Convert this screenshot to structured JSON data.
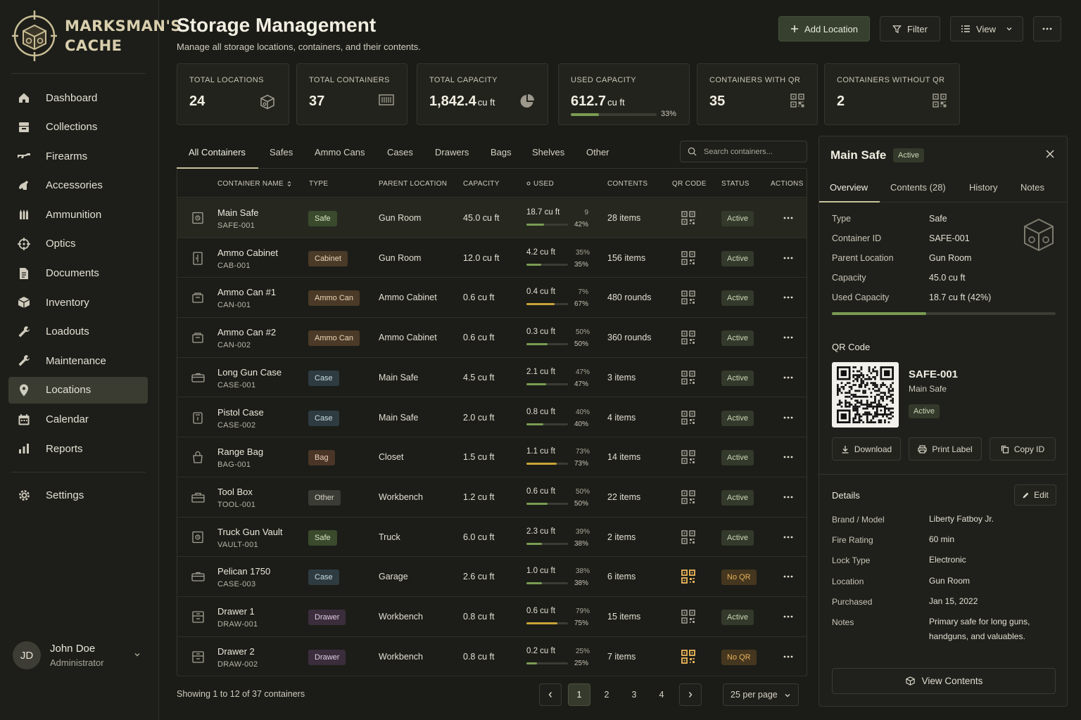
{
  "brand": {
    "line1": "MARKSMAN'S",
    "line2": "CACHE"
  },
  "nav": [
    {
      "label": "Dashboard",
      "icon": "home-icon"
    },
    {
      "label": "Collections",
      "icon": "collections-icon"
    },
    {
      "label": "Firearms",
      "icon": "rifle-icon"
    },
    {
      "label": "Accessories",
      "icon": "accessories-icon"
    },
    {
      "label": "Ammunition",
      "icon": "ammunition-icon"
    },
    {
      "label": "Optics",
      "icon": "crosshair-icon"
    },
    {
      "label": "Documents",
      "icon": "document-icon"
    },
    {
      "label": "Inventory",
      "icon": "box-icon"
    },
    {
      "label": "Loadouts",
      "icon": "wrench-icon"
    },
    {
      "label": "Maintenance",
      "icon": "wrench-icon"
    },
    {
      "label": "Locations",
      "icon": "location-pin-icon",
      "active": true
    },
    {
      "label": "Calendar",
      "icon": "calendar-icon"
    },
    {
      "label": "Reports",
      "icon": "bar-chart-icon"
    }
  ],
  "settings": {
    "label": "Settings",
    "icon": "gear-icon"
  },
  "user": {
    "initials": "JD",
    "name": "John Doe",
    "role": "Administrator"
  },
  "header": {
    "title": "Storage Management",
    "subtitle": "Manage all storage locations, containers, and their contents.",
    "add_label": "Add Location",
    "filter_label": "Filter",
    "view_label": "View"
  },
  "stats": [
    {
      "label": "TOTAL LOCATIONS",
      "value": "24",
      "unit": "",
      "icon": "cube-icon"
    },
    {
      "label": "TOTAL CONTAINERS",
      "value": "37",
      "unit": "",
      "icon": "container-icon"
    },
    {
      "label": "TOTAL CAPACITY",
      "value": "1,842.4",
      "unit": "cu ft",
      "icon": "pie-chart-icon"
    },
    {
      "label": "USED CAPACITY",
      "value": "612.7",
      "unit": "cu ft",
      "pct": "33%",
      "fraction": 0.33
    },
    {
      "label": "CONTAINERS WITH QR",
      "value": "35",
      "unit": "",
      "icon": "qr-icon"
    },
    {
      "label": "CONTAINERS WITHOUT QR",
      "value": "2",
      "unit": "",
      "icon": "qr-icon"
    }
  ],
  "tabs": [
    "All Containers",
    "Safes",
    "Ammo Cans",
    "Cases",
    "Drawers",
    "Bags",
    "Shelves",
    "Other"
  ],
  "search": {
    "placeholder": "Search containers..."
  },
  "columns": [
    "CONTAINER NAME",
    "TYPE",
    "PARENT LOCATION",
    "CAPACITY",
    "USED",
    "CONTENTS",
    "QR CODE",
    "STATUS",
    "ACTIONS"
  ],
  "rows": [
    {
      "name": "Main Safe",
      "id": "SAFE-001",
      "type": "Safe",
      "badge": "safe",
      "parent": "Gun Room",
      "capacity": "45.0 cu ft",
      "used": "18.7 cu ft",
      "pct_top": "9",
      "pct": "42%",
      "fraction": 0.42,
      "contents": "28 items",
      "qr": true,
      "status": "Active",
      "icon": "safe-icon",
      "selected": true
    },
    {
      "name": "Ammo Cabinet",
      "id": "CAB-001",
      "type": "Cabinet",
      "badge": "cabinet",
      "parent": "Gun Room",
      "capacity": "12.0 cu ft",
      "used": "4.2 cu ft",
      "pct_top": "35%",
      "pct": "35%",
      "fraction": 0.35,
      "contents": "156 items",
      "qr": true,
      "status": "Active",
      "icon": "cabinet-icon"
    },
    {
      "name": "Ammo Can #1",
      "id": "CAN-001",
      "type": "Ammo Can",
      "badge": "ammo",
      "parent": "Ammo Cabinet",
      "capacity": "0.6 cu ft",
      "used": "0.4 cu ft",
      "pct_top": "7%",
      "pct": "67%",
      "fraction": 0.67,
      "contents": "480 rounds",
      "qr": true,
      "status": "Active",
      "icon": "ammo-can-icon"
    },
    {
      "name": "Ammo Can #2",
      "id": "CAN-002",
      "type": "Ammo Can",
      "badge": "ammo",
      "parent": "Ammo Cabinet",
      "capacity": "0.6 cu ft",
      "used": "0.3 cu ft",
      "pct_top": "50%",
      "pct": "50%",
      "fraction": 0.5,
      "contents": "360 rounds",
      "qr": true,
      "status": "Active",
      "icon": "ammo-can-icon"
    },
    {
      "name": "Long Gun Case",
      "id": "CASE-001",
      "type": "Case",
      "badge": "case",
      "parent": "Main Safe",
      "capacity": "4.5 cu ft",
      "used": "2.1 cu ft",
      "pct_top": "47%",
      "pct": "47%",
      "fraction": 0.47,
      "contents": "3 items",
      "qr": true,
      "status": "Active",
      "icon": "case-icon"
    },
    {
      "name": "Pistol Case",
      "id": "CASE-002",
      "type": "Case",
      "badge": "case",
      "parent": "Main Safe",
      "capacity": "2.0 cu ft",
      "used": "0.8 cu ft",
      "pct_top": "40%",
      "pct": "40%",
      "fraction": 0.4,
      "contents": "4 items",
      "qr": true,
      "status": "Active",
      "icon": "pistol-case-icon"
    },
    {
      "name": "Range Bag",
      "id": "BAG-001",
      "type": "Bag",
      "badge": "bag",
      "parent": "Closet",
      "capacity": "1.5 cu ft",
      "used": "1.1 cu ft",
      "pct_top": "73%",
      "pct": "73%",
      "fraction": 0.73,
      "contents": "14 items",
      "qr": true,
      "status": "Active",
      "icon": "bag-icon"
    },
    {
      "name": "Tool Box",
      "id": "TOOL-001",
      "type": "Other",
      "badge": "other",
      "parent": "Workbench",
      "capacity": "1.2 cu ft",
      "used": "0.6 cu ft",
      "pct_top": "50%",
      "pct": "50%",
      "fraction": 0.5,
      "contents": "22 items",
      "qr": true,
      "status": "Active",
      "icon": "toolbox-icon"
    },
    {
      "name": "Truck Gun Vault",
      "id": "VAULT-001",
      "type": "Safe",
      "badge": "safe",
      "parent": "Truck",
      "capacity": "6.0 cu ft",
      "used": "2.3 cu ft",
      "pct_top": "39%",
      "pct": "38%",
      "fraction": 0.38,
      "contents": "2 items",
      "qr": true,
      "status": "Active",
      "icon": "safe-icon"
    },
    {
      "name": "Pelican 1750",
      "id": "CASE-003",
      "type": "Case",
      "badge": "case",
      "parent": "Garage",
      "capacity": "2.6 cu ft",
      "used": "1.0 cu ft",
      "pct_top": "38%",
      "pct": "38%",
      "fraction": 0.38,
      "contents": "6 items",
      "qr": false,
      "status": "No QR",
      "icon": "case-icon"
    },
    {
      "name": "Drawer 1",
      "id": "DRAW-001",
      "type": "Drawer",
      "badge": "drawer",
      "parent": "Workbench",
      "capacity": "0.8 cu ft",
      "used": "0.6 cu ft",
      "pct_top": "79%",
      "pct": "75%",
      "fraction": 0.75,
      "contents": "15 items",
      "qr": true,
      "status": "Active",
      "icon": "drawer-icon"
    },
    {
      "name": "Drawer 2",
      "id": "DRAW-002",
      "type": "Drawer",
      "badge": "drawer",
      "parent": "Workbench",
      "capacity": "0.8 cu ft",
      "used": "0.2 cu ft",
      "pct_top": "25%",
      "pct": "25%",
      "fraction": 0.25,
      "contents": "7 items",
      "qr": false,
      "status": "No QR",
      "icon": "drawer-icon"
    }
  ],
  "footer": {
    "showing": "Showing 1 to 12 of 37 containers",
    "pages": [
      "1",
      "2",
      "3",
      "4"
    ],
    "per_page": "25 per page"
  },
  "panel": {
    "title": "Main Safe",
    "status": "Active",
    "tabs": [
      "Overview",
      "Contents (28)",
      "History",
      "Notes"
    ],
    "overview": [
      {
        "k": "Type",
        "v": "Safe"
      },
      {
        "k": "Container ID",
        "v": "SAFE-001"
      },
      {
        "k": "Parent Location",
        "v": "Gun Room"
      },
      {
        "k": "Capacity",
        "v": "45.0 cu ft"
      },
      {
        "k": "Used Capacity",
        "v": "18.7 cu ft (42%)"
      }
    ],
    "used_fraction": 0.42,
    "qr_heading": "QR Code",
    "qr_id": "SAFE-001",
    "qr_name": "Main Safe",
    "qr_status": "Active",
    "download_label": "Download",
    "print_label": "Print Label",
    "copy_label": "Copy ID",
    "details_heading": "Details",
    "edit_label": "Edit",
    "details": [
      {
        "k": "Brand / Model",
        "v": "Liberty Fatboy Jr."
      },
      {
        "k": "Fire Rating",
        "v": "60 min"
      },
      {
        "k": "Lock Type",
        "v": "Electronic"
      },
      {
        "k": "Location",
        "v": "Gun Room"
      },
      {
        "k": "Purchased",
        "v": "Jan 15, 2022"
      },
      {
        "k": "Notes",
        "v": "Primary safe for long guns, handguns, and valuables."
      }
    ],
    "view_contents_label": "View Contents"
  },
  "colors": {
    "bar_green": "#7a9c53",
    "bar_yellow": "#c9a437",
    "accent": "#c8c39f",
    "no_qr": "#e6b25a"
  }
}
